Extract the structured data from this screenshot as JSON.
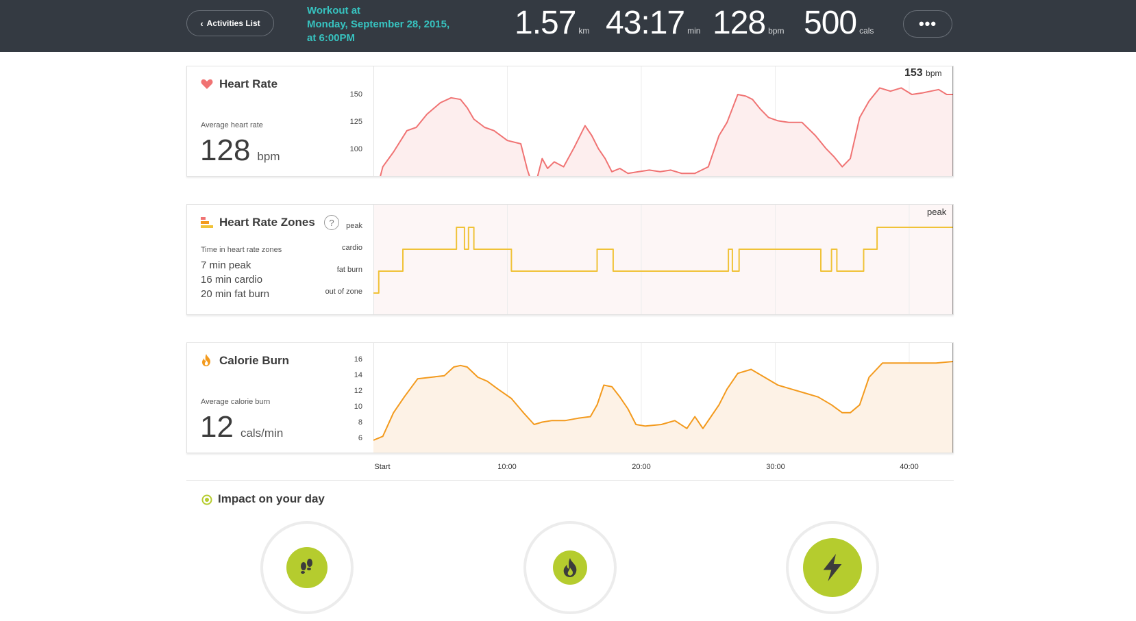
{
  "header": {
    "back_label": "Activities List",
    "workout_title_line1": "Workout at",
    "workout_title_line2": "Monday, September 28, 2015,",
    "workout_title_line3": "at 6:00PM",
    "stats": [
      {
        "value": "1.57",
        "unit": "km"
      },
      {
        "value": "43:17",
        "unit": "min"
      },
      {
        "value": "128",
        "unit": "bpm"
      },
      {
        "value": "500",
        "unit": "cals"
      }
    ],
    "more_label": "•••"
  },
  "heart_rate": {
    "title": "Heart Rate",
    "avg_label": "Average heart rate",
    "avg_value": "128",
    "avg_unit": "bpm",
    "peak_marker_value": "153",
    "peak_marker_unit": "bpm",
    "y_ticks": [
      "150",
      "125",
      "100"
    ]
  },
  "zones": {
    "title": "Heart Rate Zones",
    "help_label": "?",
    "time_label": "Time in heart rate zones",
    "lines": [
      "7 min peak",
      "16 min cardio",
      "20 min fat burn"
    ],
    "y_ticks": [
      "peak",
      "cardio",
      "fat burn",
      "out of zone"
    ],
    "marker_label": "peak"
  },
  "calories": {
    "title": "Calorie Burn",
    "avg_label": "Average calorie burn",
    "avg_value": "12",
    "avg_unit": "cals/min",
    "y_ticks": [
      "16",
      "14",
      "12",
      "10",
      "8",
      "6"
    ]
  },
  "x_axis": [
    "Start",
    "10:00",
    "20:00",
    "30:00",
    "40:00"
  ],
  "impact": {
    "title": "Impact on your day"
  },
  "colors": {
    "heart": "#f07373",
    "zones": "#f0c238",
    "calories": "#f39a1d",
    "accent": "#37c3c0",
    "impact": "#b5cc2e"
  },
  "chart_data": [
    {
      "type": "area",
      "title": "Heart Rate",
      "x_unit": "min",
      "xlim": [
        0,
        43.3
      ],
      "ylim": [
        80,
        160
      ],
      "x": [
        0,
        0.7,
        1.5,
        2.5,
        3.2,
        4,
        5,
        5.8,
        6.5,
        7,
        7.5,
        8.3,
        9,
        10,
        11,
        11.5,
        12,
        12.6,
        13,
        13.5,
        14.2,
        15,
        15.8,
        16.3,
        16.8,
        17.3,
        17.8,
        18.4,
        19,
        19.8,
        20.6,
        21.4,
        22.2,
        23,
        24,
        25,
        25.8,
        26.4,
        27.2,
        27.8,
        28.3,
        28.9,
        29.5,
        30.2,
        31,
        32,
        33,
        33.8,
        34.4,
        35,
        35.6,
        36.3,
        37,
        37.8,
        38.6,
        39.4,
        40.2,
        41,
        41.6,
        42.2,
        42.8,
        43.3
      ],
      "y": [
        84,
        106,
        115,
        128,
        130,
        138,
        145,
        148,
        147,
        142,
        135,
        130,
        128,
        122,
        120,
        104,
        92,
        111,
        105,
        109,
        106,
        118,
        131,
        125,
        117,
        111,
        103,
        105,
        102,
        103,
        104,
        103,
        104,
        102,
        102,
        106,
        125,
        133,
        150,
        149,
        147,
        141,
        136,
        134,
        133,
        133,
        125,
        117,
        112,
        106,
        111,
        136,
        146,
        154,
        152,
        154,
        150,
        151,
        152,
        153,
        150,
        150
      ]
    },
    {
      "type": "line",
      "title": "Heart Rate Zones",
      "categories_y": [
        "out of zone",
        "fat burn",
        "cardio",
        "peak"
      ],
      "x_unit": "min",
      "xlim": [
        0,
        43.3
      ],
      "x": [
        0,
        0.4,
        0.4,
        2.2,
        2.2,
        6.2,
        6.2,
        6.8,
        6.8,
        7.1,
        7.1,
        7.5,
        7.5,
        10.3,
        10.3,
        16.7,
        16.7,
        16.9,
        16.9,
        17.9,
        17.9,
        26.5,
        26.5,
        26.8,
        26.8,
        27.3,
        27.3,
        33.4,
        33.4,
        34.2,
        34.2,
        34.6,
        34.6,
        36.6,
        36.6,
        37.6,
        37.6,
        43.3
      ],
      "y": [
        0,
        0,
        1,
        1,
        2,
        2,
        3,
        3,
        2,
        2,
        3,
        3,
        2,
        2,
        1,
        1,
        2,
        2,
        2,
        2,
        1,
        1,
        2,
        2,
        1,
        1,
        2,
        2,
        1,
        1,
        2,
        2,
        1,
        1,
        2,
        2,
        3,
        3
      ]
    },
    {
      "type": "area",
      "title": "Calorie Burn",
      "x_unit": "min",
      "xlim": [
        0,
        43.3
      ],
      "ylim": [
        5,
        17
      ],
      "x": [
        0,
        0.7,
        1.5,
        2.3,
        3.3,
        4.3,
        5.3,
        6,
        6.5,
        7,
        7.8,
        8.5,
        9.3,
        10.3,
        11.2,
        12,
        12.6,
        13.3,
        14.3,
        15.3,
        16.2,
        16.7,
        17.2,
        17.8,
        18.4,
        19,
        19.6,
        20.3,
        21.5,
        22.5,
        23.4,
        24,
        24.6,
        25.2,
        25.8,
        26.4,
        27.2,
        28.2,
        29.2,
        30.2,
        31.2,
        32.2,
        33.2,
        34.2,
        35,
        35.6,
        36.3,
        37,
        38,
        39,
        40,
        41,
        42,
        43.3
      ],
      "y": [
        6,
        6.5,
        9.5,
        11.5,
        13.8,
        14,
        14.2,
        15.3,
        15.5,
        15.3,
        14,
        13.5,
        12.5,
        11.3,
        9.5,
        8,
        8.3,
        8.5,
        8.5,
        8.8,
        9,
        10.5,
        13,
        12.8,
        11.5,
        10,
        8,
        7.8,
        8,
        8.5,
        7.5,
        9,
        7.5,
        9,
        10.5,
        12.5,
        14.5,
        15,
        14,
        13,
        12.5,
        12,
        11.5,
        10.5,
        9.5,
        9.5,
        10.5,
        14,
        15.8,
        15.8,
        15.8,
        15.8,
        15.8,
        16
      ]
    }
  ]
}
